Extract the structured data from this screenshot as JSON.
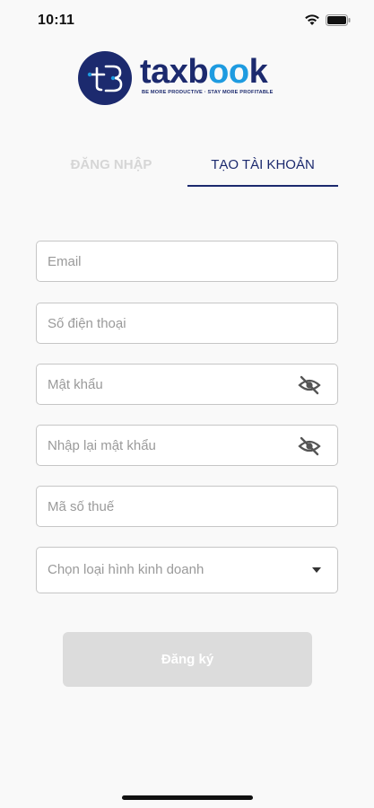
{
  "status_bar": {
    "time": "10:11"
  },
  "logo": {
    "wordmark_prefix": "taxb",
    "wordmark_oo": "oo",
    "wordmark_suffix": "k",
    "tagline": "BE MORE PRODUCTIVE · STAY MORE PROFITABLE"
  },
  "tabs": {
    "login": "ĐĂNG NHẬP",
    "register": "TẠO TÀI KHOẢN",
    "active": "register"
  },
  "form": {
    "email": {
      "placeholder": "Email",
      "value": ""
    },
    "phone": {
      "placeholder": "Số điện thoại",
      "value": ""
    },
    "password": {
      "placeholder": "Mật khẩu",
      "value": ""
    },
    "confirm_password": {
      "placeholder": "Nhập lại mật khẩu",
      "value": ""
    },
    "tax_code": {
      "placeholder": "Mã số thuế",
      "value": ""
    },
    "business_type": {
      "placeholder": "Chọn loại hình kinh doanh"
    },
    "submit_label": "Đăng ký"
  },
  "colors": {
    "brand_navy": "#1c2a6e",
    "brand_blue": "#1e9be0",
    "disabled_button": "#dcdcdc"
  }
}
